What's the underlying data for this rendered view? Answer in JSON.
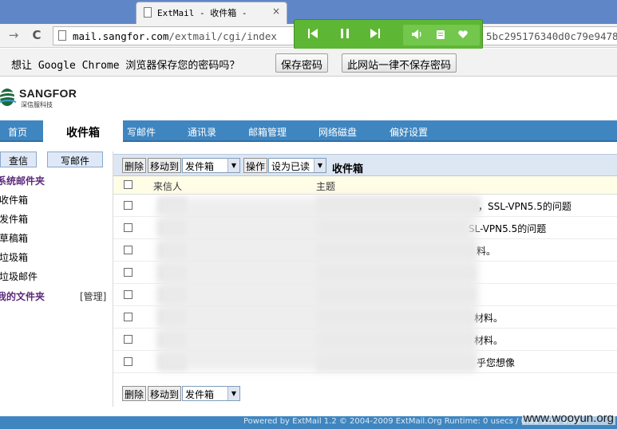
{
  "browser": {
    "tab_title": "ExtMail - 收件箱 -",
    "tab_close": "×",
    "back_icon": "→",
    "reload_icon": "C",
    "url_domain": "mail.sangfor.com",
    "url_path": "/extmail/cgi/index",
    "url_tail": "5bc295176340d0c79e9478"
  },
  "player": {
    "buttons": [
      "prev-track",
      "pause",
      "next-track",
      "volume",
      "playlist",
      "favorite"
    ]
  },
  "password_bar": {
    "message": "想让 Google Chrome 浏览器保存您的密码吗？",
    "save_label": "保存密码",
    "never_label": "此网站一律不保存密码"
  },
  "brand": {
    "name": "SANGFOR",
    "subtitle": "深信服科技"
  },
  "nav": {
    "items": [
      "首页",
      "收件箱",
      "写邮件",
      "通讯录",
      "邮箱管理",
      "网络磁盘",
      "偏好设置"
    ],
    "active": "收件箱"
  },
  "sidebar": {
    "search_label": "查信",
    "compose_label": "写邮件",
    "system_folders_title": "系统邮件夹",
    "folders": [
      "收件箱",
      "发件箱",
      "草稿箱",
      "垃圾箱",
      "垃圾邮件"
    ],
    "my_folders_title": "我的文件夹",
    "manage_label": "[管理]"
  },
  "toolbar": {
    "delete_label": "删除",
    "move_to_label": "移动到",
    "move_target": "发件箱",
    "operate_label": "操作",
    "mark_as": "设为已读",
    "current_folder": "收件箱"
  },
  "table": {
    "header_sender": "来信人",
    "header_subject": "主题",
    "rows": [
      {
        "subject_visible": "，SSL-VPN5.5的问题"
      },
      {
        "subject_visible": "SL-VPN5.5的问题"
      },
      {
        "subject_visible": "料。"
      },
      {
        "subject_visible": ""
      },
      {
        "subject_visible": ""
      },
      {
        "subject_visible": "材料。"
      },
      {
        "subject_visible": "材料。"
      },
      {
        "subject_visible": "乎您想像"
      }
    ]
  },
  "bottom_toolbar": {
    "delete_label": "删除",
    "move_to_label": "移动到",
    "move_target": "发件箱"
  },
  "footer": {
    "text": "Powered by ExtMail 1.2 © 2004-2009 ExtMail.Org Runtime: 0 usecs / 0.03 sec / 0.03"
  },
  "watermark": "www.wooyun.org",
  "colors": {
    "nav_blue": "#3f86c0",
    "player_green": "#5db734",
    "folder_title_purple": "#5a2a7a",
    "header_yellow": "#fffde6"
  }
}
